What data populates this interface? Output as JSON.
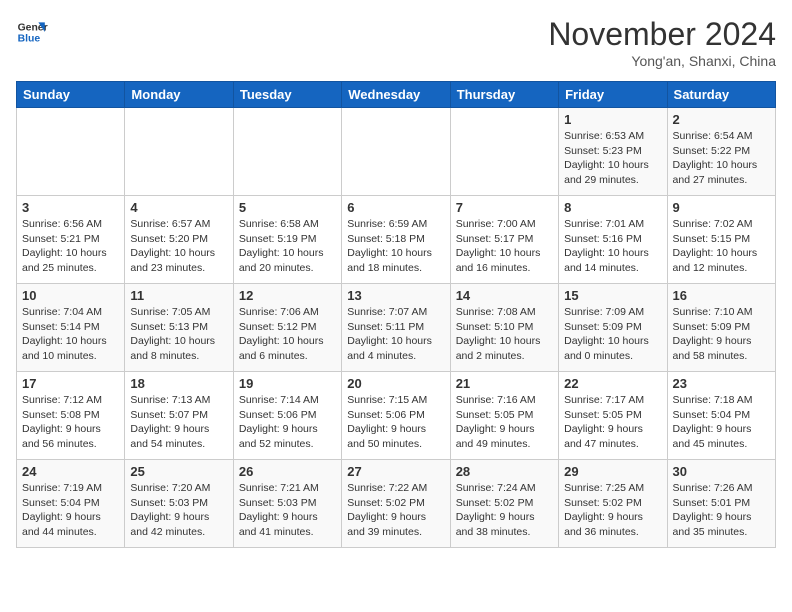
{
  "logo": {
    "line1": "General",
    "line2": "Blue"
  },
  "header": {
    "month": "November 2024",
    "location": "Yong'an, Shanxi, China"
  },
  "days_of_week": [
    "Sunday",
    "Monday",
    "Tuesday",
    "Wednesday",
    "Thursday",
    "Friday",
    "Saturday"
  ],
  "weeks": [
    [
      {
        "day": "",
        "info": ""
      },
      {
        "day": "",
        "info": ""
      },
      {
        "day": "",
        "info": ""
      },
      {
        "day": "",
        "info": ""
      },
      {
        "day": "",
        "info": ""
      },
      {
        "day": "1",
        "info": "Sunrise: 6:53 AM\nSunset: 5:23 PM\nDaylight: 10 hours and 29 minutes."
      },
      {
        "day": "2",
        "info": "Sunrise: 6:54 AM\nSunset: 5:22 PM\nDaylight: 10 hours and 27 minutes."
      }
    ],
    [
      {
        "day": "3",
        "info": "Sunrise: 6:56 AM\nSunset: 5:21 PM\nDaylight: 10 hours and 25 minutes."
      },
      {
        "day": "4",
        "info": "Sunrise: 6:57 AM\nSunset: 5:20 PM\nDaylight: 10 hours and 23 minutes."
      },
      {
        "day": "5",
        "info": "Sunrise: 6:58 AM\nSunset: 5:19 PM\nDaylight: 10 hours and 20 minutes."
      },
      {
        "day": "6",
        "info": "Sunrise: 6:59 AM\nSunset: 5:18 PM\nDaylight: 10 hours and 18 minutes."
      },
      {
        "day": "7",
        "info": "Sunrise: 7:00 AM\nSunset: 5:17 PM\nDaylight: 10 hours and 16 minutes."
      },
      {
        "day": "8",
        "info": "Sunrise: 7:01 AM\nSunset: 5:16 PM\nDaylight: 10 hours and 14 minutes."
      },
      {
        "day": "9",
        "info": "Sunrise: 7:02 AM\nSunset: 5:15 PM\nDaylight: 10 hours and 12 minutes."
      }
    ],
    [
      {
        "day": "10",
        "info": "Sunrise: 7:04 AM\nSunset: 5:14 PM\nDaylight: 10 hours and 10 minutes."
      },
      {
        "day": "11",
        "info": "Sunrise: 7:05 AM\nSunset: 5:13 PM\nDaylight: 10 hours and 8 minutes."
      },
      {
        "day": "12",
        "info": "Sunrise: 7:06 AM\nSunset: 5:12 PM\nDaylight: 10 hours and 6 minutes."
      },
      {
        "day": "13",
        "info": "Sunrise: 7:07 AM\nSunset: 5:11 PM\nDaylight: 10 hours and 4 minutes."
      },
      {
        "day": "14",
        "info": "Sunrise: 7:08 AM\nSunset: 5:10 PM\nDaylight: 10 hours and 2 minutes."
      },
      {
        "day": "15",
        "info": "Sunrise: 7:09 AM\nSunset: 5:09 PM\nDaylight: 10 hours and 0 minutes."
      },
      {
        "day": "16",
        "info": "Sunrise: 7:10 AM\nSunset: 5:09 PM\nDaylight: 9 hours and 58 minutes."
      }
    ],
    [
      {
        "day": "17",
        "info": "Sunrise: 7:12 AM\nSunset: 5:08 PM\nDaylight: 9 hours and 56 minutes."
      },
      {
        "day": "18",
        "info": "Sunrise: 7:13 AM\nSunset: 5:07 PM\nDaylight: 9 hours and 54 minutes."
      },
      {
        "day": "19",
        "info": "Sunrise: 7:14 AM\nSunset: 5:06 PM\nDaylight: 9 hours and 52 minutes."
      },
      {
        "day": "20",
        "info": "Sunrise: 7:15 AM\nSunset: 5:06 PM\nDaylight: 9 hours and 50 minutes."
      },
      {
        "day": "21",
        "info": "Sunrise: 7:16 AM\nSunset: 5:05 PM\nDaylight: 9 hours and 49 minutes."
      },
      {
        "day": "22",
        "info": "Sunrise: 7:17 AM\nSunset: 5:05 PM\nDaylight: 9 hours and 47 minutes."
      },
      {
        "day": "23",
        "info": "Sunrise: 7:18 AM\nSunset: 5:04 PM\nDaylight: 9 hours and 45 minutes."
      }
    ],
    [
      {
        "day": "24",
        "info": "Sunrise: 7:19 AM\nSunset: 5:04 PM\nDaylight: 9 hours and 44 minutes."
      },
      {
        "day": "25",
        "info": "Sunrise: 7:20 AM\nSunset: 5:03 PM\nDaylight: 9 hours and 42 minutes."
      },
      {
        "day": "26",
        "info": "Sunrise: 7:21 AM\nSunset: 5:03 PM\nDaylight: 9 hours and 41 minutes."
      },
      {
        "day": "27",
        "info": "Sunrise: 7:22 AM\nSunset: 5:02 PM\nDaylight: 9 hours and 39 minutes."
      },
      {
        "day": "28",
        "info": "Sunrise: 7:24 AM\nSunset: 5:02 PM\nDaylight: 9 hours and 38 minutes."
      },
      {
        "day": "29",
        "info": "Sunrise: 7:25 AM\nSunset: 5:02 PM\nDaylight: 9 hours and 36 minutes."
      },
      {
        "day": "30",
        "info": "Sunrise: 7:26 AM\nSunset: 5:01 PM\nDaylight: 9 hours and 35 minutes."
      }
    ]
  ]
}
